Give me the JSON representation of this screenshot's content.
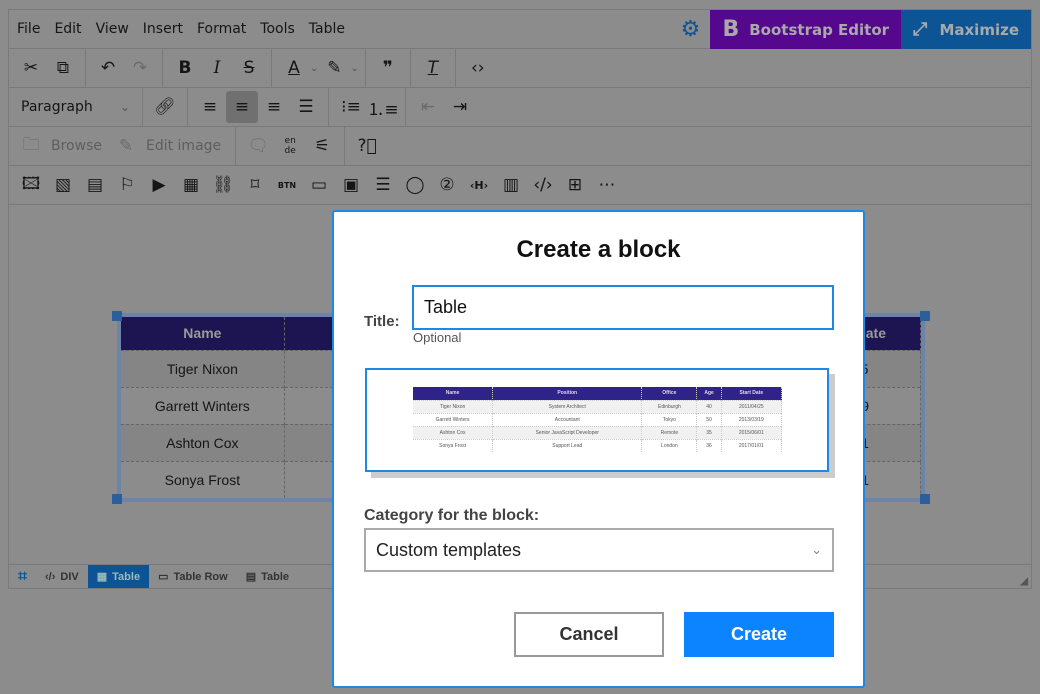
{
  "menu": [
    "File",
    "Edit",
    "View",
    "Insert",
    "Format",
    "Tools",
    "Table"
  ],
  "topbar": {
    "bootstrap_editor": "Bootstrap Editor",
    "maximize": "Maximize",
    "settings_icon": "gear-icon"
  },
  "toolbar": {
    "paragraph": "Paragraph",
    "browse": "Browse",
    "edit_image": "Edit image",
    "lang_top": "en",
    "lang_bottom": "de"
  },
  "colors": {
    "accent": "#1e88e5",
    "bootstrap_purple": "#55088d",
    "maximize_blue": "#0d5494",
    "create_button": "#0d84ff",
    "table_header": "#2f2289"
  },
  "background_table": {
    "headers": [
      "Name",
      "Position",
      "Office",
      "Age",
      "Start Date"
    ],
    "rows": [
      [
        "Tiger Nixon",
        "System Architect",
        "Edinburgh",
        "40",
        "2011/04/25"
      ],
      [
        "Garrett Winters",
        "Accountant",
        "Tokyo",
        "50",
        "2013/03/19"
      ],
      [
        "Ashton Cox",
        "Senior JavaScript Developer",
        "Remote",
        "35",
        "2015/06/01"
      ],
      [
        "Sonya Frost",
        "Support Lead",
        "London",
        "36",
        "2017/01/01"
      ]
    ]
  },
  "statusbar": [
    "DIV",
    "Table",
    "Table Row",
    "Table"
  ],
  "modal": {
    "title": "Create a block",
    "title_label": "Title:",
    "title_value": "Table",
    "title_hint": "Optional",
    "category_label": "Category for the block:",
    "category_value": "Custom templates",
    "cancel": "Cancel",
    "create": "Create"
  }
}
